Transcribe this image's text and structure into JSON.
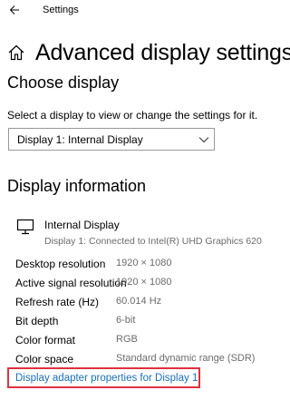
{
  "window": {
    "title": "Settings"
  },
  "header": {
    "title": "Advanced display settings"
  },
  "choose_display": {
    "heading": "Choose display",
    "description": "Select a display to view or change the settings for it.",
    "dropdown_value": "Display 1: Internal Display"
  },
  "display_info": {
    "heading": "Display information",
    "display_name": "Internal Display",
    "connection": "Display 1: Connected to Intel(R) UHD Graphics 620",
    "rows": [
      {
        "label": "Desktop resolution",
        "value": "1920 × 1080"
      },
      {
        "label": "Active signal resolution",
        "value": "1920 × 1080"
      },
      {
        "label": "Refresh rate (Hz)",
        "value": "60.014 Hz"
      },
      {
        "label": "Bit depth",
        "value": "6-bit"
      },
      {
        "label": "Color format",
        "value": "RGB"
      },
      {
        "label": "Color space",
        "value": "Standard dynamic range (SDR)"
      }
    ],
    "adapter_link": "Display adapter properties for Display 1"
  },
  "icons": {
    "back": "back-arrow-icon",
    "home": "home-icon",
    "dropdown": "chevron-down-icon",
    "monitor": "monitor-icon"
  },
  "colors": {
    "link": "#1a6fb8",
    "highlight_border": "#e03040",
    "secondary_text": "#6b6b6b"
  }
}
